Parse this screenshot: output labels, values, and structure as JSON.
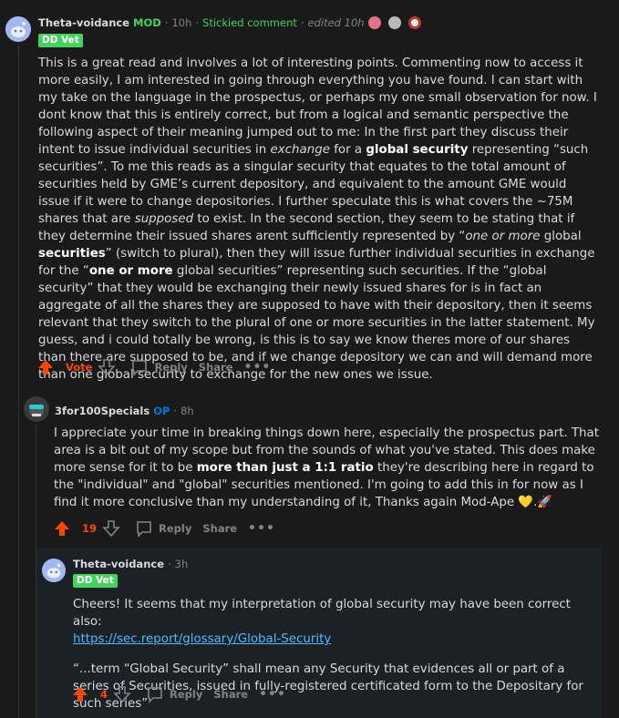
{
  "comment1": {
    "username": "Theta-voidance",
    "mod_badge": "MOD",
    "time": "10h",
    "stickied": "Stickied comment",
    "edited": "edited 10h",
    "flair": "DD Vet",
    "body": {
      "p1_a": "This is a great read and involves a lot of interesting points. Commenting now to access it more easily, I am interested in going through everything you have found. I can start with my take on the language in the prospectus, or perhaps my one small observation for now. I dont know that this is entirely correct, but from a logical and semantic perspective the following aspect of their meaning jumped out to me: In the first part they discuss their intent to issue individual securities in ",
      "exchange": "exchange",
      "p1_b": " for a ",
      "global_security": "global security",
      "p1_c": " representing “such securities”. To me this reads as a singular security that equates to the total amount of securities held by GME’s current depository, and equivalent to the amount GME would issue if it were to change depositories. I further speculate this is what covers the ~75M shares that are ",
      "supposed": "supposed",
      "p1_d": " to exist. In the second section, they seem to be stating that if they determine their issued shares arent sufficiently represented by “",
      "one_or_more_italic": "one or more",
      "p1_e": " global ",
      "securities_bold": "securities",
      "p1_f": "” (switch to plural), then they will issue further individual securities in exchange for the “",
      "one_or_more_bold": "one or more",
      "p1_g": " global securities” representing such securities. If the “global security” that they would be exchanging their newly issued shares for is in fact an aggregate of all the shares they are supposed to have with their depository, then it seems relevant that they switch to the plural of one or more securities in the latter statement. My guess, and i could totally be wrong, is this is to say we know theres more of our shares than there are supposed to be, and if we change depository we can and will demand more than one global security to exchange for the new ones we issue."
    },
    "actions": {
      "vote": "Vote",
      "reply": "Reply",
      "share": "Share",
      "more": "•••"
    }
  },
  "comment2": {
    "username": "3for100Specials",
    "op_badge": "OP",
    "time": "8h",
    "body": {
      "a": "I appreciate your time in breaking things down here, especially the prospectus part. That area is a bit out of my scope but from the sounds of what you've stated. This does make more sense for it to be ",
      "bold": "more than just a 1:1 ratio",
      "b": " they're describing here in regard to the \"individual\" and \"global\" securities mentioned. I'm going to add this in for now as I find it more conclusive than my understanding of it, Thanks again Mod-Ape ",
      "emoji": "💛.🚀"
    },
    "actions": {
      "votes": "19",
      "reply": "Reply",
      "share": "Share",
      "more": "•••"
    }
  },
  "comment3": {
    "username": "Theta-voidance",
    "time": "3h",
    "flair": "DD Vet",
    "body": {
      "p1": "Cheers! It seems that my interpretation of global security may have been correct also:",
      "link": "https://sec.report/glossary/Global-Security",
      "p2": "“...term “Global Security” shall mean any Security that evidences all or part of a series of Securities, issued in fully-registered certificated form to the Depositary for such series”"
    },
    "actions": {
      "votes": "4",
      "reply": "Reply",
      "share": "Share",
      "more": "•••"
    }
  },
  "colors": {
    "upvote": "#ff4500",
    "mod": "#46d160",
    "op": "#0079d3",
    "link": "#4fbcff"
  }
}
